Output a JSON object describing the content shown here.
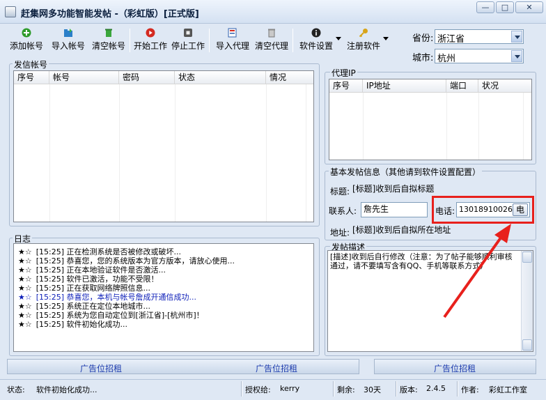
{
  "window": {
    "title": "赶集网多功能智能发帖 -（彩虹版）[正式版]",
    "controls": {
      "minimize": "—",
      "maximize": "□",
      "close": "✕"
    }
  },
  "toolbar": {
    "add_account": "添加帐号",
    "import_account": "导入帐号",
    "clear_account": "清空帐号",
    "start": "开始工作",
    "stop": "停止工作",
    "import_proxy": "导入代理",
    "clear_proxy": "清空代理",
    "settings": "软件设置",
    "register": "注册软件"
  },
  "location": {
    "province_label": "省份:",
    "province_value": "浙江省",
    "city_label": "城市:",
    "city_value": "杭州"
  },
  "accounts": {
    "title": "发信帐号",
    "columns": [
      "序号",
      "帐号",
      "密码",
      "状态",
      "情况"
    ]
  },
  "proxy": {
    "title": "代理IP",
    "columns": [
      "序号",
      "IP地址",
      "端口",
      "状况"
    ]
  },
  "log": {
    "title": "日志",
    "stars": "★☆",
    "lines": [
      {
        "time": "[15:25]",
        "text": "正在检测系统是否被修改或破坏..."
      },
      {
        "time": "[15:25]",
        "text": "恭喜您，您的系统版本为官方版本，请放心使用..."
      },
      {
        "time": "[15:25]",
        "text": "正在本地验证软件是否激活..."
      },
      {
        "time": "[15:25]",
        "text": "软件已激活，功能不受限！"
      },
      {
        "time": "[15:25]",
        "text": "正在获取网络牌照信息..."
      },
      {
        "time": "[15:25]",
        "text": "恭喜您，本机与帐号詹成开通信成功..."
      },
      {
        "time": "[15:25]",
        "text": "系统正在定位本地城市..."
      },
      {
        "time": "[15:25]",
        "text": "系统为您自动定位到[浙江省]-[杭州市]！"
      },
      {
        "time": "[15:25]",
        "text": "软件初始化成功..."
      }
    ]
  },
  "basic_info": {
    "title": "基本发帖信息（其他请到软件设置配置）",
    "title_label": "标题:",
    "title_value": "[标题]收到后自拟标题",
    "contact_label": "联系人:",
    "contact_value": "詹先生",
    "phone_label": "电话:",
    "phone_value": "13018910026",
    "phone_button": "电",
    "address_label": "地址:",
    "address_value": "[标题]收到后自拟所在地址"
  },
  "description": {
    "title": "发帖描述",
    "text": "[描述]收到后自行修改（注意：为了帖子能够顺利审核通过，请不要填写含有QQ、手机等联系方式）"
  },
  "ads": {
    "slot1": "广告位招租",
    "slot2": "广告位招租",
    "slot3": "广告位招租"
  },
  "statusbar": {
    "status_label": "状态:",
    "status_value": "软件初始化成功...",
    "license_label": "授权给:",
    "license_value": "kerry",
    "remaining_label": "剩余:",
    "remaining_value": "30天",
    "version_label": "版本:",
    "version_value": "2.4.5",
    "author_label": "作者:",
    "author_value": "彩虹工作室"
  },
  "colors": {
    "annotation_red": "#e8201c",
    "log_highlight_blue": "#0c1eb8",
    "ad_text": "#1d3cae"
  }
}
